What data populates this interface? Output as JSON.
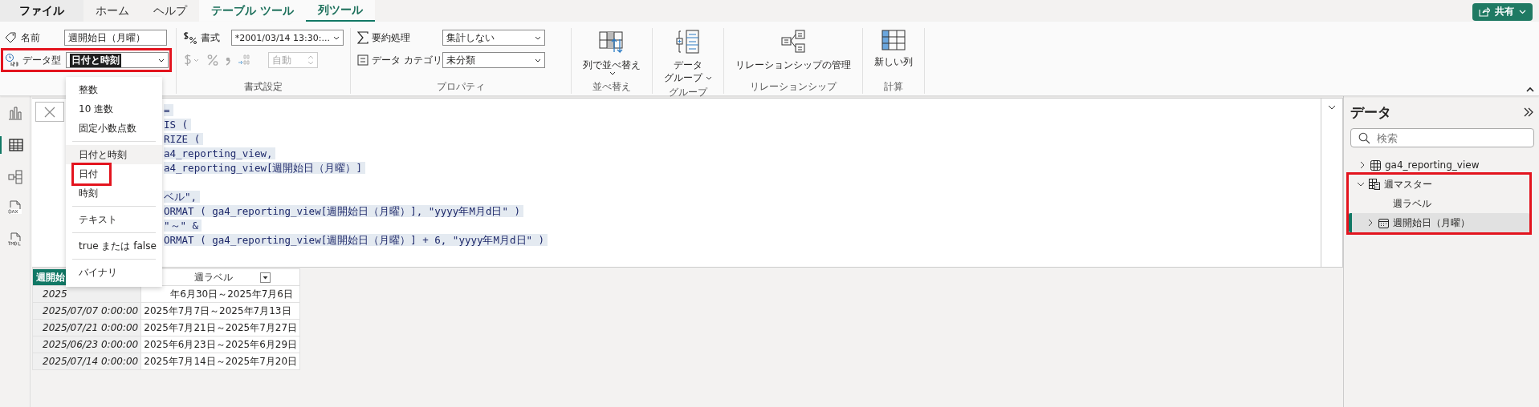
{
  "tabs": [
    {
      "label": "ファイル",
      "selected": false,
      "kind": "file"
    },
    {
      "label": "ホーム",
      "selected": false,
      "kind": "plain"
    },
    {
      "label": "ヘルプ",
      "selected": false,
      "kind": "plain"
    },
    {
      "label": "テーブル ツール",
      "selected": false,
      "kind": "context"
    },
    {
      "label": "列ツール",
      "selected": true,
      "kind": "context"
    }
  ],
  "share_button": {
    "label": "共有"
  },
  "ribbon": {
    "structure": {
      "name_label": "名前",
      "name_value": "週開始日（月曜）",
      "type_label": "データ型",
      "type_value": "日付と時刻",
      "annotated": true
    },
    "formatting": {
      "format_label": "書式",
      "format_value": "*2001/03/14 13:30:...",
      "decimal_value": "自動",
      "label": "書式設定"
    },
    "properties": {
      "summary_label": "要約処理",
      "summary_value": "集計しない",
      "category_label": "データ カテゴリ",
      "category_value": "未分類",
      "label": "プロパティ"
    },
    "commands": [
      {
        "kind": "sort",
        "lines": [
          "列で並べ替え"
        ],
        "group": "並べ替え"
      },
      {
        "kind": "group",
        "lines": [
          "データ",
          "グループ"
        ],
        "group": "グループ"
      },
      {
        "kind": "relationship",
        "lines": [
          "リレーションシップの管理"
        ],
        "group": "リレーションシップ"
      },
      {
        "kind": "new_column",
        "lines": [
          "新しい列"
        ],
        "group": "計算"
      }
    ]
  },
  "type_menu": [
    [
      {
        "label": "整数",
        "selected": false,
        "annotated": false
      },
      {
        "label": "10 進数",
        "selected": false,
        "annotated": false
      },
      {
        "label": "固定小数点数",
        "selected": false,
        "annotated": false
      }
    ],
    [
      {
        "label": "日付と時刻",
        "selected": true,
        "annotated": false
      },
      {
        "label": "日付",
        "selected": false,
        "annotated": true
      },
      {
        "label": "時刻",
        "selected": false,
        "annotated": false
      }
    ],
    [
      {
        "label": "テキスト",
        "selected": false,
        "annotated": false
      }
    ],
    [
      {
        "label": "true または false",
        "selected": false,
        "annotated": false
      }
    ],
    [
      {
        "label": "バイナリ",
        "selected": false,
        "annotated": false
      }
    ]
  ],
  "formula_blocks": [
    [
      "=",
      "IS (",
      "RIZE (",
      "a4_reporting_view,",
      "a4_reporting_view[週開始日（月曜）]"
    ],
    [
      "ベル\",",
      "ORMAT ( ga4_reporting_view[週開始日（月曜）], \"yyyy年M月d日\" )",
      "\"～\" &",
      "ORMAT ( ga4_reporting_view[週開始日（月曜）] + 6, \"yyyy年M月d日\" )"
    ]
  ],
  "table": {
    "columns": [
      {
        "label": "週開始",
        "selected": true,
        "filter": false
      },
      {
        "label": "週ラベル",
        "selected": false,
        "filter": true
      }
    ],
    "rows": [
      {
        "cells": [
          "2025",
          "年6月30日～2025年7月6日"
        ],
        "covered": true
      },
      {
        "cells": [
          "2025/07/07 0:00:00",
          "2025年7月7日～2025年7月13日"
        ],
        "covered": false
      },
      {
        "cells": [
          "2025/07/21 0:00:00",
          "2025年7月21日～2025年7月27日"
        ],
        "covered": false
      },
      {
        "cells": [
          "2025/06/23 0:00:00",
          "2025年6月23日～2025年6月29日"
        ],
        "covered": false
      },
      {
        "cells": [
          "2025/07/14 0:00:00",
          "2025年7月14日～2025年7月20日"
        ],
        "covered": false
      }
    ]
  },
  "data_panel": {
    "title": "データ",
    "search": {
      "placeholder": "検索"
    },
    "tree": [
      {
        "label": "ga4_reporting_view",
        "kind": "table",
        "expanded": false,
        "annotated": false
      },
      {
        "label": "週マスター",
        "kind": "calc_table",
        "expanded": true,
        "annotated": true,
        "children": [
          {
            "label": "週ラベル",
            "kind": "column",
            "selected": false
          },
          {
            "label": "週開始日（月曜）",
            "kind": "date_hierarchy",
            "expanded": false,
            "selected": true
          }
        ]
      }
    ]
  }
}
